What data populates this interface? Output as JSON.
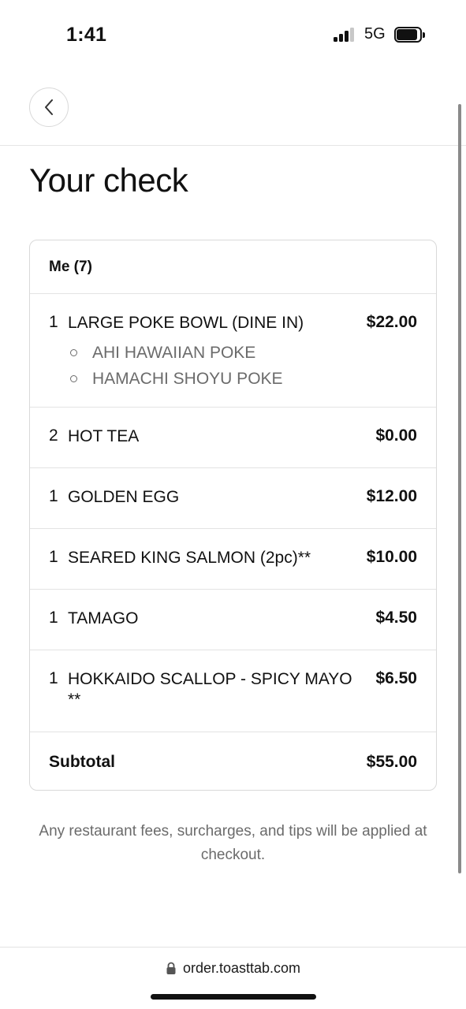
{
  "status_bar": {
    "time": "1:41",
    "network": "5G"
  },
  "header": {
    "back_icon": "chevron-left-icon"
  },
  "page": {
    "title": "Your check"
  },
  "check": {
    "guest_label": "Me (7)",
    "items": [
      {
        "qty": "1",
        "name": "LARGE POKE BOWL (DINE IN)",
        "price": "$22.00",
        "modifiers": [
          "AHI HAWAIIAN POKE",
          "HAMACHI SHOYU POKE"
        ]
      },
      {
        "qty": "2",
        "name": "HOT TEA",
        "price": "$0.00"
      },
      {
        "qty": "1",
        "name": "GOLDEN EGG",
        "price": "$12.00"
      },
      {
        "qty": "1",
        "name": "SEARED KING SALMON (2pc)**",
        "price": "$10.00"
      },
      {
        "qty": "1",
        "name": "TAMAGO",
        "price": "$4.50"
      },
      {
        "qty": "1",
        "name": "HOKKAIDO SCALLOP - SPICY MAYO **",
        "price": "$6.50"
      }
    ],
    "subtotal_label": "Subtotal",
    "subtotal_value": "$55.00"
  },
  "note": "Any restaurant fees, surcharges, and tips will be applied at checkout.",
  "browser": {
    "url": "order.toasttab.com"
  }
}
